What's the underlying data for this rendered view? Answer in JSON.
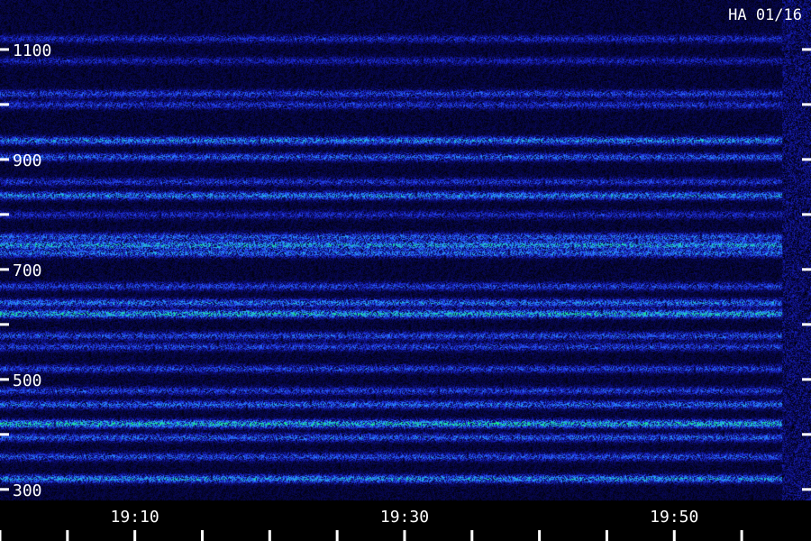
{
  "chart_data": {
    "type": "heatmap",
    "title": "HA 01/16",
    "xlabel": "",
    "ylabel": "",
    "x_ticks": [
      "19:10",
      "19:30",
      "19:50"
    ],
    "x_tick_minutes": [
      10,
      30,
      50
    ],
    "xlim_minutes": [
      0,
      58
    ],
    "y_ticks": [
      300,
      500,
      700,
      900,
      1100
    ],
    "ylim": [
      280,
      1190
    ],
    "colormap": [
      "#000000",
      "#0a0a6a",
      "#1e2cd8",
      "#2a7cff",
      "#22c8d8",
      "#18f070"
    ],
    "bands": [
      {
        "y": 1120,
        "intensity": 0.35
      },
      {
        "y": 1080,
        "intensity": 0.3
      },
      {
        "y": 1020,
        "intensity": 0.45
      },
      {
        "y": 1000,
        "intensity": 0.4
      },
      {
        "y": 935,
        "intensity": 0.7
      },
      {
        "y": 905,
        "intensity": 0.55
      },
      {
        "y": 860,
        "intensity": 0.4
      },
      {
        "y": 835,
        "intensity": 0.7
      },
      {
        "y": 800,
        "intensity": 0.35
      },
      {
        "y": 760,
        "intensity": 0.55
      },
      {
        "y": 745,
        "intensity": 0.8
      },
      {
        "y": 730,
        "intensity": 0.6
      },
      {
        "y": 670,
        "intensity": 0.45
      },
      {
        "y": 640,
        "intensity": 0.65
      },
      {
        "y": 620,
        "intensity": 0.9
      },
      {
        "y": 580,
        "intensity": 0.5
      },
      {
        "y": 560,
        "intensity": 0.45
      },
      {
        "y": 520,
        "intensity": 0.45
      },
      {
        "y": 480,
        "intensity": 0.45
      },
      {
        "y": 455,
        "intensity": 0.6
      },
      {
        "y": 420,
        "intensity": 0.95
      },
      {
        "y": 395,
        "intensity": 0.55
      },
      {
        "y": 360,
        "intensity": 0.5
      },
      {
        "y": 320,
        "intensity": 0.75
      }
    ]
  }
}
